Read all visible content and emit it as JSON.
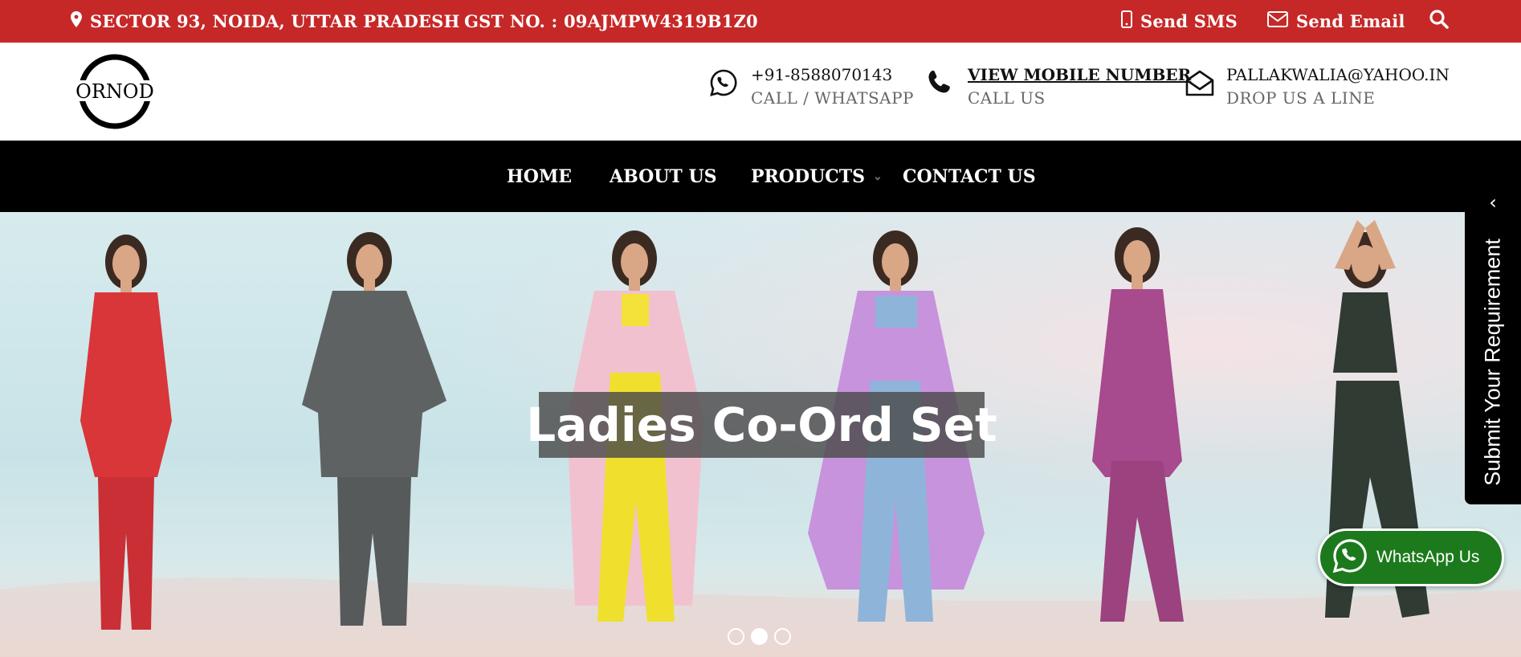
{
  "topbar": {
    "address": "SECTOR 93, NOIDA, UTTAR PRADESH",
    "gst": "GST NO. : 09AJMPW4319B1Z0",
    "send_sms": "Send SMS",
    "send_email": "Send Email"
  },
  "logo": {
    "text": "ORNOD"
  },
  "contacts": {
    "whatsapp": {
      "line1": "+91-8588070143",
      "line2": "CALL / WHATSAPP"
    },
    "phone": {
      "line1": "VIEW MOBILE NUMBER",
      "line2": "CALL US"
    },
    "email": {
      "line1": "PALLAKWALIA@YAHOO.IN",
      "line2": "DROP US A LINE"
    }
  },
  "nav": {
    "home": "HOME",
    "about": "ABOUT US",
    "products": "PRODUCTS",
    "contact": "CONTACT US"
  },
  "hero": {
    "title": "Ladies Co-Ord Set",
    "slide_count": 3,
    "active_slide": 2
  },
  "side_tab": {
    "label": "Submit Your Requirement",
    "chevron": "‹"
  },
  "whatsapp_button": {
    "label": "WhatsApp Us"
  },
  "colors": {
    "topbar": "#c62828",
    "nav": "#000000",
    "whatsapp": "#1c7a1c",
    "outfits": [
      "#d9363a",
      "#5f6263",
      "#f2c1cf",
      "#c793dd",
      "#a84a8e",
      "#2f3b33"
    ]
  },
  "icons": [
    "map-pin-icon",
    "mobile-icon",
    "envelope-icon",
    "search-icon",
    "whatsapp-icon",
    "phone-icon",
    "open-envelope-icon",
    "chevron-left-icon"
  ]
}
